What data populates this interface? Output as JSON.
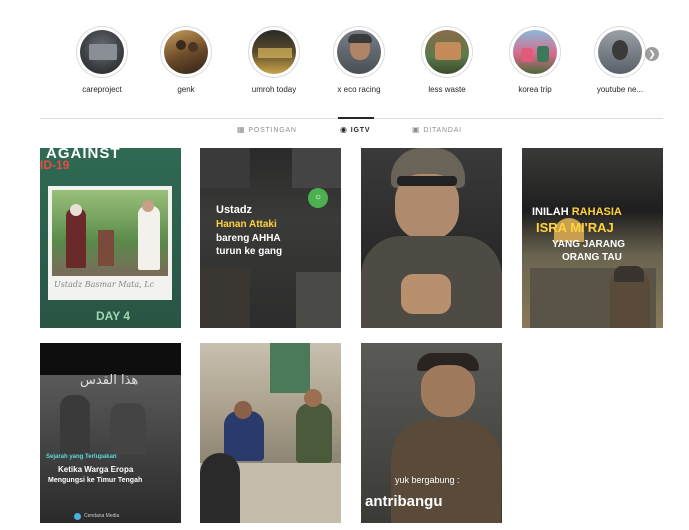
{
  "highlights": [
    {
      "label": "careproject"
    },
    {
      "label": "genk"
    },
    {
      "label": "umroh today"
    },
    {
      "label": "x eco racing"
    },
    {
      "label": "less waste"
    },
    {
      "label": "korea trip"
    },
    {
      "label": "youtube ne..."
    }
  ],
  "tabs": [
    {
      "label": "POSTINGAN",
      "icon": "grid-icon",
      "active": false
    },
    {
      "label": "IGTV",
      "icon": "igtv-icon",
      "active": true
    },
    {
      "label": "DITANDAI",
      "icon": "tagged-icon",
      "active": false
    }
  ],
  "videos": [
    {
      "top_text": "AGAINST",
      "sub_text": "ID-19",
      "bottom_text": "Ustadz Basmar Mata, Lc",
      "day_text": "DAY 4"
    },
    {
      "line1": "Ustadz",
      "line2": "Hanan Attaki",
      "line3": "bareng AHHA",
      "line4": "turun ke gang"
    },
    {},
    {
      "line1": "INILAH",
      "line1b": "RAHASIA",
      "line2": "ISRA MI'RAJ",
      "line3": "YANG JARANG",
      "line4": "ORANG TAU"
    },
    {
      "arabic": "هذا القدس",
      "tag": "Sejarah yang Terlupakan",
      "line1": "Ketika Warga Eropa",
      "line2": "Mengungsi ke Timur Tengah",
      "brand": "Cendana Media"
    },
    {},
    {
      "line1": "yuk bergabung :",
      "line2": "antribangu"
    }
  ],
  "colors": {
    "accent_green": "#3fbf87",
    "caption_yellow": "#ffd33d",
    "tab_active": "#262626",
    "tab_inactive": "#8e8e8e"
  }
}
